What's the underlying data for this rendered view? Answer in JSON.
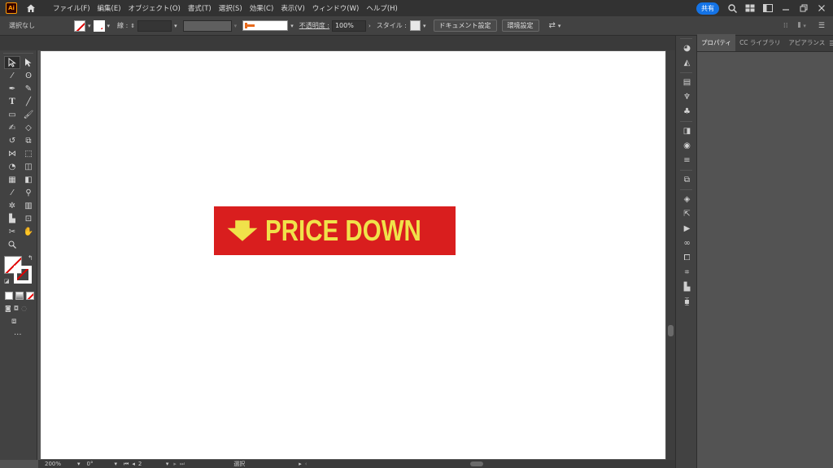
{
  "app": {
    "logo_text": "Ai",
    "share_label": "共有",
    "accent_color": "#1473e6"
  },
  "menu": [
    "ファイル(F)",
    "編集(E)",
    "オブジェクト(O)",
    "書式(T)",
    "選択(S)",
    "効果(C)",
    "表示(V)",
    "ウィンドウ(W)",
    "ヘルプ(H)"
  ],
  "control": {
    "selection_status": "選択なし",
    "stroke_label": "線 :",
    "opacity_label": "不透明度 :",
    "opacity_value": "100%",
    "style_label": "スタイル :",
    "doc_settings_label": "ドキュメント設定",
    "preferences_label": "環境設定"
  },
  "canvas": {
    "banner_text": "PRICE DOWN",
    "banner_bg": "#d91e1e",
    "banner_fg": "#f0e24a"
  },
  "status": {
    "zoom": "200%",
    "rotation": "0°",
    "artboard_num": "2",
    "tool_name": "選択"
  },
  "panel": {
    "tabs": [
      "プロパティ",
      "CC ライブラリ",
      "アピアランス"
    ]
  }
}
